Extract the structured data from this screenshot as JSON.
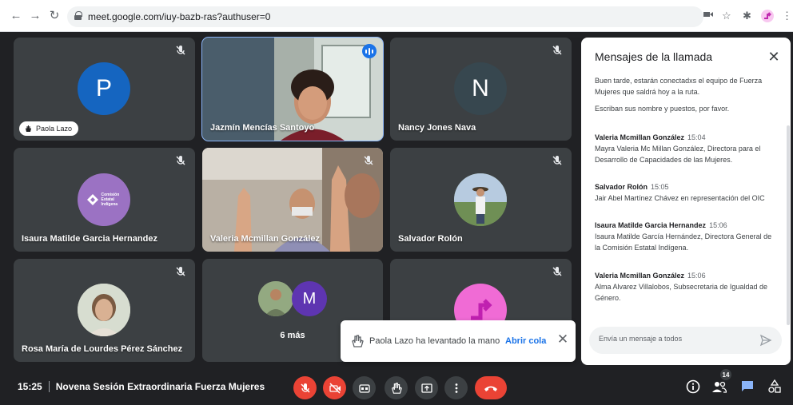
{
  "browser": {
    "url": "meet.google.com/iuy-bazb-ras?authuser=0",
    "back_icon": "arrow-left-icon",
    "forward_icon": "arrow-right-icon",
    "reload_icon": "reload-icon"
  },
  "tiles": {
    "paola": {
      "initial": "P",
      "chip_label": "Paola Lazo",
      "avatar_color": "#1565c0"
    },
    "jazmin": {
      "name": "Jazmín Mencías Santoyo"
    },
    "nancy": {
      "initial": "N",
      "name": "Nancy Jones Nava",
      "avatar_color": "#37474f"
    },
    "isaura": {
      "name": "Isaura Matilde Garcia Hernandez",
      "logo_text": "Comisión Estatal Indígena",
      "avatar_color": "#9b72c3"
    },
    "valeria": {
      "name": "Valeria Mcmillan González"
    },
    "salvador": {
      "name": "Salvador Rolón"
    },
    "rosa": {
      "name": "Rosa María de Lourdes Pérez Sánchez"
    },
    "more": {
      "initial": "M",
      "label": "6 más",
      "avatar_color": "#5e35b1"
    },
    "last": {
      "avatar_color": "#f06bd5"
    }
  },
  "toast": {
    "message": "Paola Lazo ha levantado la mano",
    "action": "Abrir cola"
  },
  "chat": {
    "title": "Mensajes de la llamada",
    "intro_1": "Buen tarde, estarán conectadxs el equipo de Fuerza Mujeres que saldrá hoy a la ruta.",
    "intro_2": "Escriban sus nombre y puestos, por favor.",
    "messages": [
      {
        "sender": "Valeria Mcmillan González",
        "time": "15:04",
        "text": "Mayra Valeria Mc Millan González, Directora para el Desarrollo de Capacidades de las Mujeres."
      },
      {
        "sender": "Salvador Rolón",
        "time": "15:05",
        "text": "Jair Abel Martínez Chávez en representación del OIC"
      },
      {
        "sender": "Isaura Matilde Garcia Hernandez",
        "time": "15:06",
        "text": "Isaura Matilde García Hernández, Directora General de la Comisión Estatal Indígena."
      },
      {
        "sender": "Valeria Mcmillan González",
        "time": "15:06",
        "text": "Alma Alvarez Villalobos, Subsecretaria de Igualdad de Género."
      }
    ],
    "input_placeholder": "Envía un mensaje a todos"
  },
  "bottom": {
    "time": "15:25",
    "meeting_title": "Novena Sesión Extraordinaria Fuerza Mujeres",
    "participants_count": "14"
  },
  "colors": {
    "background": "#202124",
    "tile": "#3c4043",
    "danger": "#ea4335",
    "accent": "#1a73e8"
  }
}
